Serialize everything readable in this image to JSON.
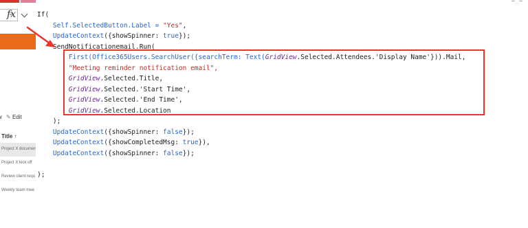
{
  "left_panel": {
    "fx_label": "fx",
    "toolbar": {
      "view_label": "w",
      "edit_label": "Edit"
    },
    "column_header": "Title ↑",
    "rows": [
      "Project X documen",
      "Project X kick off",
      "Review client requ",
      "Weekly team mee"
    ]
  },
  "code": {
    "l1": "If(",
    "l2a": "Self.SelectedButton.Label = ",
    "l2b": "\"Yes\"",
    "l2c": ",",
    "l3a": "UpdateContext",
    "l3b": "({showSpinner: ",
    "l3c": "true",
    "l3d": "});",
    "l4": "SendNotificationemail.Run(",
    "l5a": "First(Office365Users.SearchUser({searchTerm: ",
    "l5b": "Text(",
    "l5c": "GridView",
    "l5d": ".Selected.Attendees.'Display Name'})).Mail,",
    "l6": "\"Meeting reminder notification email\",",
    "l7a": "GridView",
    "l7b": ".Selected.Title,",
    "l8a": "GridView",
    "l8b": ".Selected.'Start Time',",
    "l9a": "GridView",
    "l9b": ".Selected.'End Time',",
    "l10a": "GridView",
    "l10b": ".Selected.Location",
    "l11": ");",
    "l12a": "UpdateContext",
    "l12b": "({showSpinner: ",
    "l12c": "false",
    "l12d": "});",
    "l13a": "UpdateContext",
    "l13b": "({showCompletedMsg: ",
    "l13c": "true",
    "l13d": "}),",
    "l14a": "UpdateContext",
    "l14b": "({showSpinner: ",
    "l14c": "false",
    "l14d": "});",
    "l15": "",
    "l16": ");"
  },
  "colors": {
    "accent": "#e86b1c",
    "highlight": "#e8352d",
    "keyword": "#2965c2",
    "string": "#b3342b"
  }
}
